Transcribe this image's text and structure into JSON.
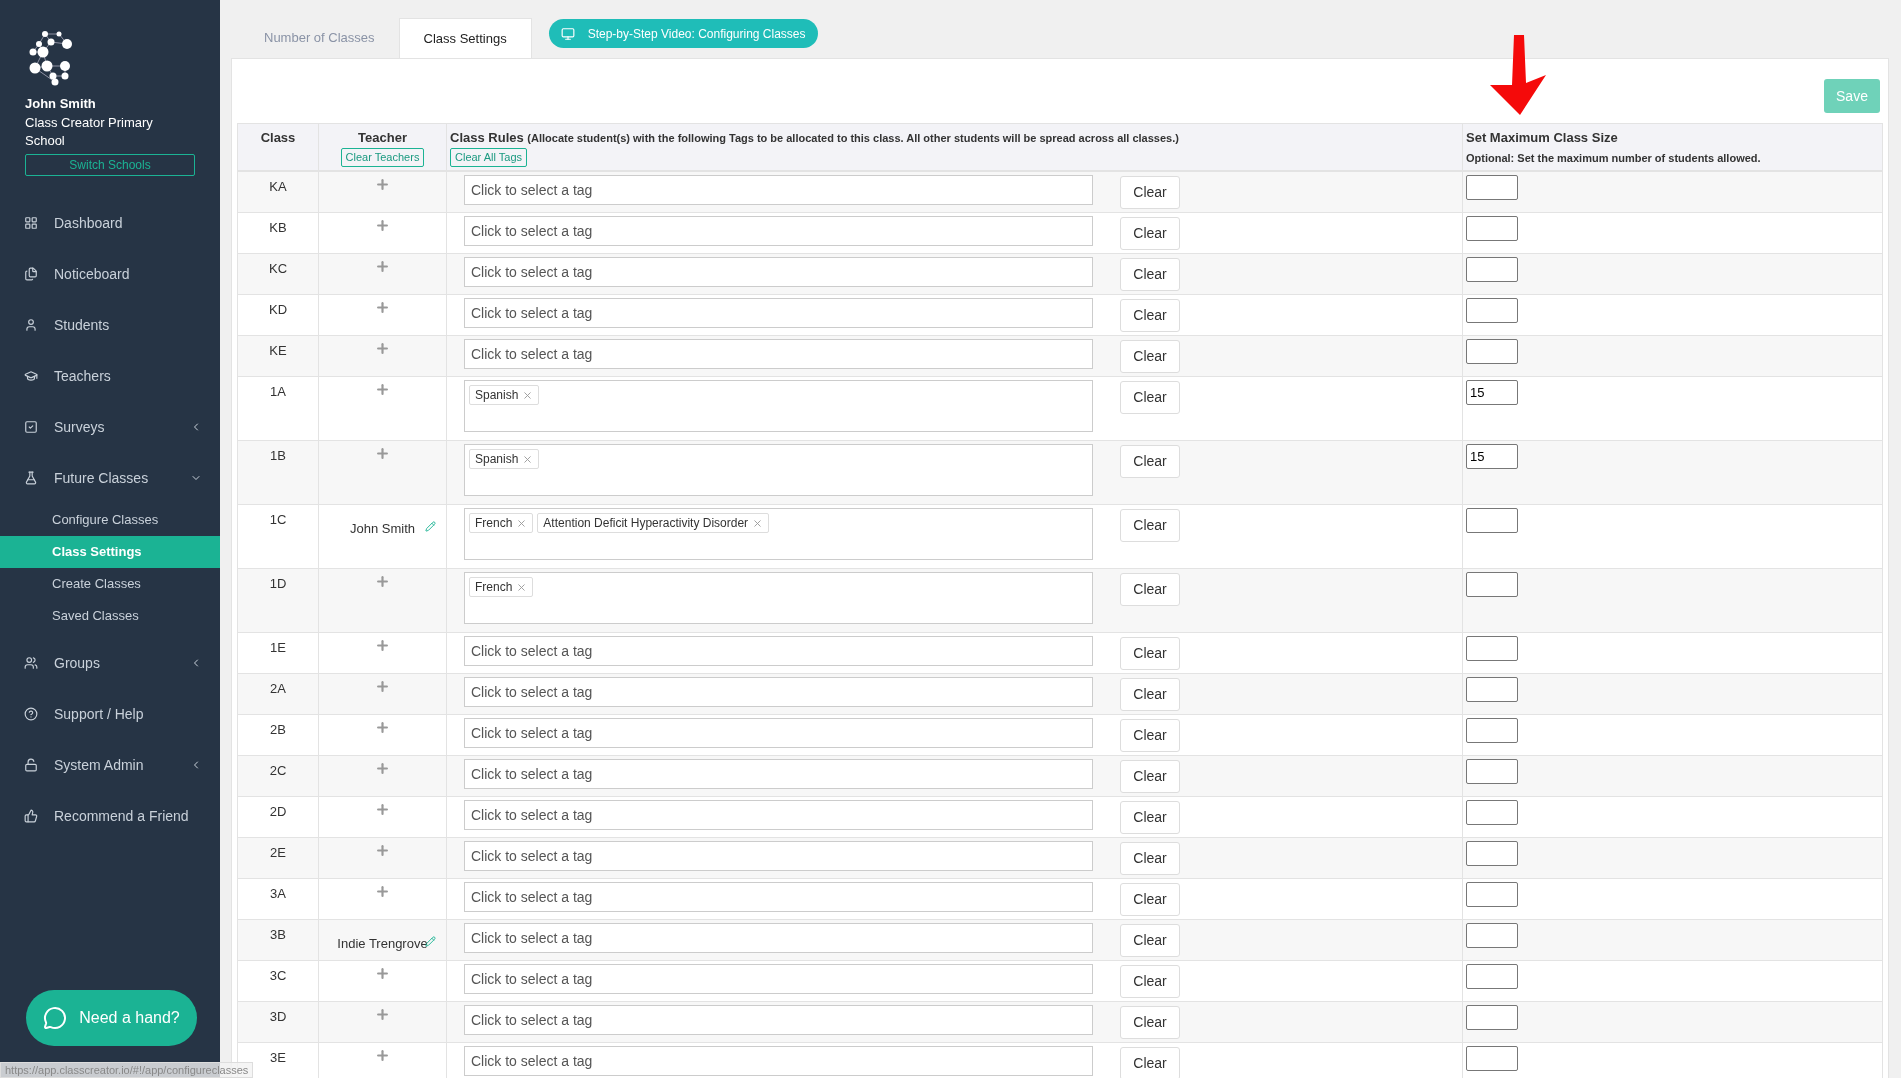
{
  "sidebar": {
    "user_name": "John Smith",
    "school": "Class Creator Primary School",
    "switch_button": "Switch Schools",
    "items": [
      {
        "label": "Dashboard"
      },
      {
        "label": "Noticeboard"
      },
      {
        "label": "Students"
      },
      {
        "label": "Teachers"
      },
      {
        "label": "Surveys",
        "expanded": false
      },
      {
        "label": "Future Classes",
        "expanded": true,
        "children": [
          {
            "label": "Configure Classes",
            "selected": false
          },
          {
            "label": "Class Settings",
            "selected": true
          },
          {
            "label": "Create Classes",
            "selected": false
          },
          {
            "label": "Saved Classes",
            "selected": false
          }
        ]
      },
      {
        "label": "Groups",
        "expanded": false
      },
      {
        "label": "Support / Help"
      },
      {
        "label": "System Admin",
        "expanded": false
      },
      {
        "label": "Recommend a Friend"
      }
    ],
    "help_button": "Need a hand?"
  },
  "tabs": [
    {
      "label": "Number of Classes",
      "selected": false
    },
    {
      "label": "Class Settings",
      "selected": true
    }
  ],
  "video_button": "Step-by-Step Video: Configuring Classes",
  "save_button": "Save",
  "table": {
    "columns": {
      "class": "Class",
      "teacher": "Teacher",
      "clear_teachers": "Clear Teachers",
      "rules": "Class Rules",
      "rules_note": "(Allocate student(s) with the following Tags to be allocated to this class. All other students will be spread across all classes.)",
      "clear_tags": "Clear All Tags",
      "max_size": "Set Maximum Class Size",
      "max_note": "Optional: Set the maximum number of students allowed."
    },
    "rows": [
      {
        "class": "KA",
        "placeholder": "Click to select a tag",
        "clear": "Clear"
      },
      {
        "class": "KB",
        "placeholder": "Click to select a tag",
        "clear": "Clear"
      },
      {
        "class": "KC",
        "placeholder": "Click to select a tag",
        "clear": "Clear"
      },
      {
        "class": "KD",
        "placeholder": "Click to select a tag",
        "clear": "Clear"
      },
      {
        "class": "KE",
        "placeholder": "Click to select a tag",
        "clear": "Clear"
      },
      {
        "class": "1A",
        "tags": [
          "Spanish"
        ],
        "clear": "Clear",
        "max_size": "15"
      },
      {
        "class": "1B",
        "tags": [
          "Spanish"
        ],
        "clear": "Clear",
        "max_size": "15"
      },
      {
        "class": "1C",
        "teacher": "John Smith",
        "tags": [
          "French",
          "Attention Deficit Hyperactivity Disorder"
        ],
        "clear": "Clear"
      },
      {
        "class": "1D",
        "tags": [
          "French"
        ],
        "clear": "Clear"
      },
      {
        "class": "1E",
        "placeholder": "Click to select a tag",
        "clear": "Clear"
      },
      {
        "class": "2A",
        "placeholder": "Click to select a tag",
        "clear": "Clear"
      },
      {
        "class": "2B",
        "placeholder": "Click to select a tag",
        "clear": "Clear"
      },
      {
        "class": "2C",
        "placeholder": "Click to select a tag",
        "clear": "Clear"
      },
      {
        "class": "2D",
        "placeholder": "Click to select a tag",
        "clear": "Clear"
      },
      {
        "class": "2E",
        "placeholder": "Click to select a tag",
        "clear": "Clear"
      },
      {
        "class": "3A",
        "placeholder": "Click to select a tag",
        "clear": "Clear"
      },
      {
        "class": "3B",
        "teacher": "Indie Trengrove",
        "placeholder": "Click to select a tag",
        "clear": "Clear"
      },
      {
        "class": "3C",
        "placeholder": "Click to select a tag",
        "clear": "Clear"
      },
      {
        "class": "3D",
        "placeholder": "Click to select a tag",
        "clear": "Clear"
      },
      {
        "class": "3E",
        "placeholder": "Click to select a tag",
        "clear": "Clear"
      }
    ]
  },
  "status_bar": "https://app.classcreator.io/#!/app/configureclasses"
}
